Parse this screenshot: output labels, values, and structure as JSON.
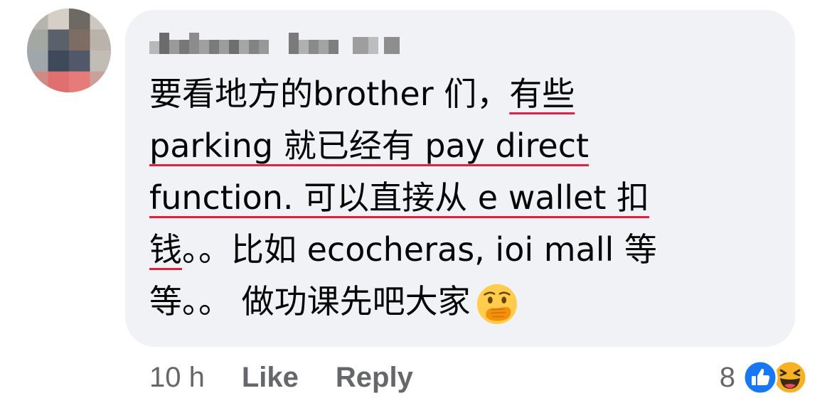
{
  "comment": {
    "lines": [
      {
        "a": "要看地方的brother 们，",
        "u": "有些"
      },
      {
        "u": "parking 就已经有 pay direct"
      },
      {
        "u": "function. 可以直接从 e wallet 扣"
      },
      {
        "u": "钱",
        "b": "。。比如 ecocheras, ioi mall 等"
      },
      {
        "a": "等。。 做功课先吧大家"
      }
    ]
  },
  "meta": {
    "time": "10 h",
    "like_label": "Like",
    "reply_label": "Reply",
    "reaction_count": "8"
  },
  "icons": {
    "like_reaction": "thumbs-up-icon",
    "haha_reaction": "laughing-face-icon",
    "emoji": "face-with-hand-over-mouth-icon"
  },
  "colors": {
    "bubble": "#f0f2f5",
    "meta_text": "#65676b",
    "like_blue": "#1877f2",
    "underline": "#e41e3f"
  }
}
